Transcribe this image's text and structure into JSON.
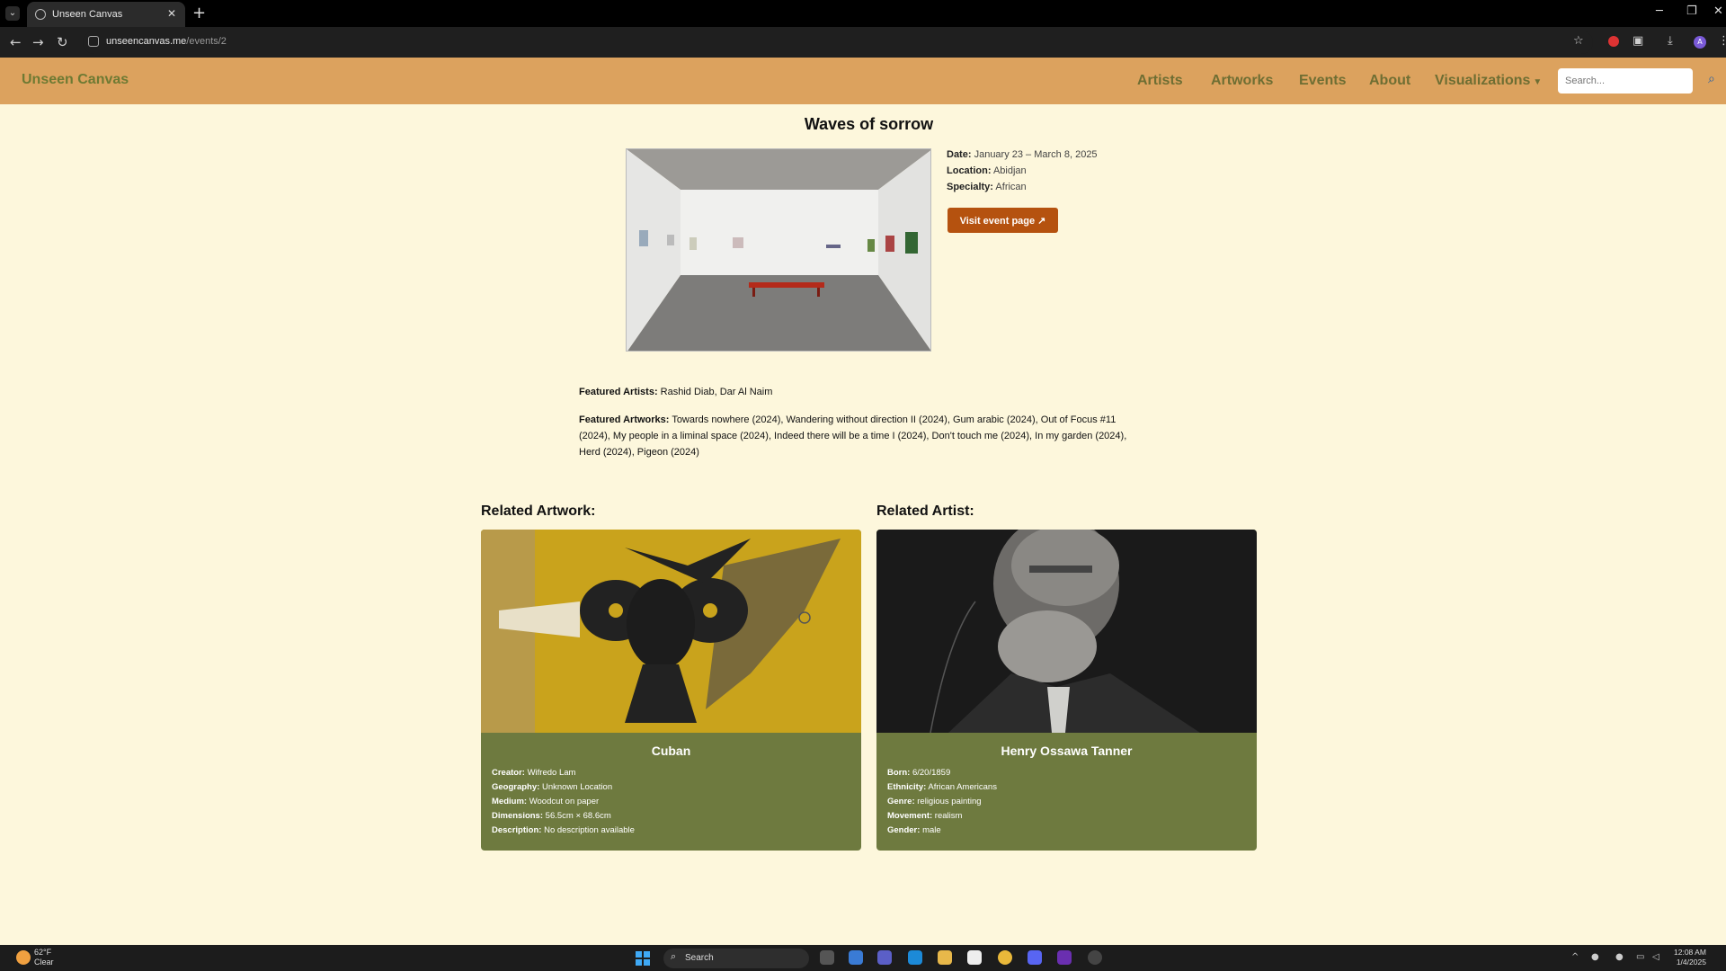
{
  "browser": {
    "tab_title": "Unseen Canvas",
    "url_host": "unseencanvas.me",
    "url_path": "/events/2"
  },
  "nav": {
    "brand": "Unseen Canvas",
    "links": [
      "Artists",
      "Artworks",
      "Events",
      "About",
      "Visualizations"
    ],
    "search_placeholder": "Search..."
  },
  "event": {
    "title": "Waves of sorrow",
    "date_label": "Date:",
    "date": "January 23 – March 8, 2025",
    "location_label": "Location:",
    "location": "Abidjan",
    "specialty_label": "Specialty:",
    "specialty": "African",
    "visit_button": "Visit event page ↗",
    "featured_artists_label": "Featured Artists:",
    "featured_artists": "Rashid Diab, Dar Al Naim",
    "featured_artworks_label": "Featured Artworks:",
    "featured_artworks": "Towards nowhere (2024), Wandering without direction II (2024), Gum arabic (2024), Out of Focus #11 (2024), My people in a liminal space (2024), Indeed there will be a time I (2024), Don't touch me (2024), In my garden (2024), Herd (2024), Pigeon (2024)"
  },
  "related_artwork": {
    "heading": "Related Artwork:",
    "title": "Cuban",
    "fields": [
      {
        "label": "Creator:",
        "value": "Wifredo Lam"
      },
      {
        "label": "Geography:",
        "value": "Unknown Location"
      },
      {
        "label": "Medium:",
        "value": "Woodcut on paper"
      },
      {
        "label": "Dimensions:",
        "value": "56.5cm × 68.6cm"
      },
      {
        "label": "Description:",
        "value": "No description available"
      }
    ]
  },
  "related_artist": {
    "heading": "Related Artist:",
    "name": "Henry Ossawa Tanner",
    "fields": [
      {
        "label": "Born:",
        "value": "6/20/1859"
      },
      {
        "label": "Ethnicity:",
        "value": "African Americans"
      },
      {
        "label": "Genre:",
        "value": "religious painting"
      },
      {
        "label": "Movement:",
        "value": "realism"
      },
      {
        "label": "Gender:",
        "value": "male"
      }
    ]
  },
  "taskbar": {
    "weather_temp": "62°F",
    "weather_desc": "Clear",
    "search": "Search",
    "time": "12:08 AM",
    "date": "1/4/2025"
  },
  "colors": {
    "navbar": "#dca25e",
    "page_bg": "#fdf7dc",
    "card_bg": "#6e7a3f",
    "button": "#b5520f"
  }
}
